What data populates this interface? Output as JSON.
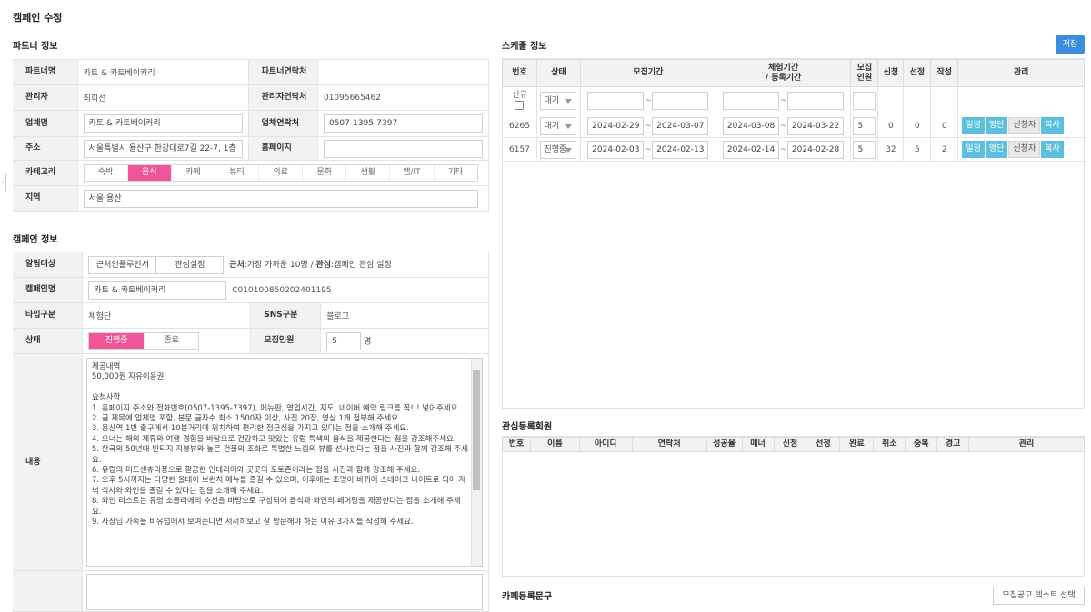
{
  "page_title": "캠페인 수정",
  "partner": {
    "title": "파트너 정보",
    "name_label": "파트너명",
    "name_value": "카토 & 카토베이커리",
    "contact_label": "파트너연락처",
    "contact_value": "",
    "manager_label": "관리자",
    "manager_value": "최희선",
    "manager_contact_label": "관리자연락처",
    "manager_contact_value": "01095665462",
    "company_label": "업체명",
    "company_value": "카토 & 카토베이커리",
    "company_contact_label": "업체연락처",
    "company_contact_value": "0507-1395-7397",
    "address_label": "주소",
    "address_value": "서울특별시 용산구 한강대로7길 22-7, 1층",
    "homepage_label": "홈페이지",
    "homepage_value": "",
    "category_label": "카테고리",
    "categories": [
      "숙박",
      "음식",
      "카페",
      "뷰티",
      "의료",
      "문화",
      "생활",
      "앱/IT",
      "기타"
    ],
    "category_selected": "음식",
    "region_label": "지역",
    "region_value": "서울 용산"
  },
  "campaign": {
    "title": "캠페인 정보",
    "notify_label": "알림대상",
    "notify_btn1": "근처인플루언서",
    "notify_btn2": "관심설정",
    "notify_desc_b1": "근처",
    "notify_desc_t1": ":가장 가까운 10명 / ",
    "notify_desc_b2": "관심",
    "notify_desc_t2": ":캠페인 관심 설정",
    "name_label": "캠페인명",
    "name_value": "카토 & 카토베이커리",
    "code": "C010100850202401195",
    "type_label": "타입구분",
    "type_value": "체험단",
    "sns_label": "SNS구분",
    "sns_value": "블로그",
    "status_label": "상태",
    "status_on": "진행중",
    "status_off": "종료",
    "recruit_label": "모집인원",
    "recruit_value": "5",
    "recruit_unit": "명",
    "content_label": "내용",
    "content_text": "제공내역\n50,000원 자유이용권\n\n요청사항\n1. 홈페이지 주소와 전화번호(0507-1395-7397), 메뉴판, 영업시간, 지도, 네이버 예약 링크를 꼭!!! 넣어주세요.\n2. 글 제목에 업체명 포함, 본문 글자수 최소 1500자 이상, 사진 20장, 영상 1개 첨부해 주세요.\n3. 용산역 1번 출구에서 10분거리에 위치하여 편리한 접근성을 가지고 있다는 점을 소개해 주세요.\n4. 오너는 해외 제류와 여행 경험을 바탕으로 건강하고 맛있는 유럽 특색의 음식을 제공한다는 점을 강조해주세요.\n5. 한국의 50년대 빈티지 지붕뷰와 높은 건물의 조화로 특별한 느낌의 뷰를 선사한다는 점을 사진과 함께 강조해 주세요.\n6. 유럽의 미드센츄리풍으로 깔끔한 인테리어와 곳곳의 포토존이라는 점을 사진과 함께 강조해 주세요.\n7. 오후 5시까지는 다양한 올데이 브런치 메뉴를 즐길 수 있으며, 이후에는 조명이 바뀌어 스테이크 나이트로 되어 저녁 식사와 와인을 즐길 수 있다는 점을 소개해 주세요.\n8. 와인 리스트는 유명 소믈리에의 추천을 바탕으로 구성되어 음식과 와인의 페어링을 제공한다는 점을 소개해 주세요.\n9. 사장님 가족들 비유럽에서 보여준다면 서서히보고 잘 방문해야 하는 이유 3가지를 작성해 주세요."
  },
  "schedule": {
    "title": "스케줄 정보",
    "save_label": "저장",
    "headers": {
      "no": "번호",
      "status": "상태",
      "recruit_period": "모집기간",
      "exp_period": "체험기간\n/ 등록기간",
      "recruit_count": "모집\n인원",
      "apply": "신청",
      "select": "선정",
      "write": "작성",
      "manage": "관리"
    },
    "new_label": "신규",
    "new_status": "대기",
    "rows": [
      {
        "no": "6265",
        "status": "대기",
        "rs": "2024-02-29",
        "re": "2024-03-07",
        "es": "2024-03-08",
        "ee": "2024-03-22",
        "count": "5",
        "apply": "0",
        "select": "0",
        "write": "0"
      },
      {
        "no": "6157",
        "status": "진행중",
        "rs": "2024-02-03",
        "re": "2024-02-13",
        "es": "2024-02-14",
        "ee": "2024-02-28",
        "count": "5",
        "apply": "32",
        "select": "5",
        "write": "2"
      }
    ],
    "btn_schedule": "일정",
    "btn_list": "명단",
    "btn_applicant": "신청자",
    "btn_copy": "복사"
  },
  "interest": {
    "title": "관심등록회원",
    "headers": [
      "번호",
      "이름",
      "아이디",
      "연락처",
      "성공율",
      "매너",
      "신청",
      "선정",
      "완료",
      "취소",
      "중복",
      "경고",
      "관리"
    ]
  },
  "cafe": {
    "title": "카페등록문구",
    "select_btn": "모집공고 텍스트 선택"
  }
}
